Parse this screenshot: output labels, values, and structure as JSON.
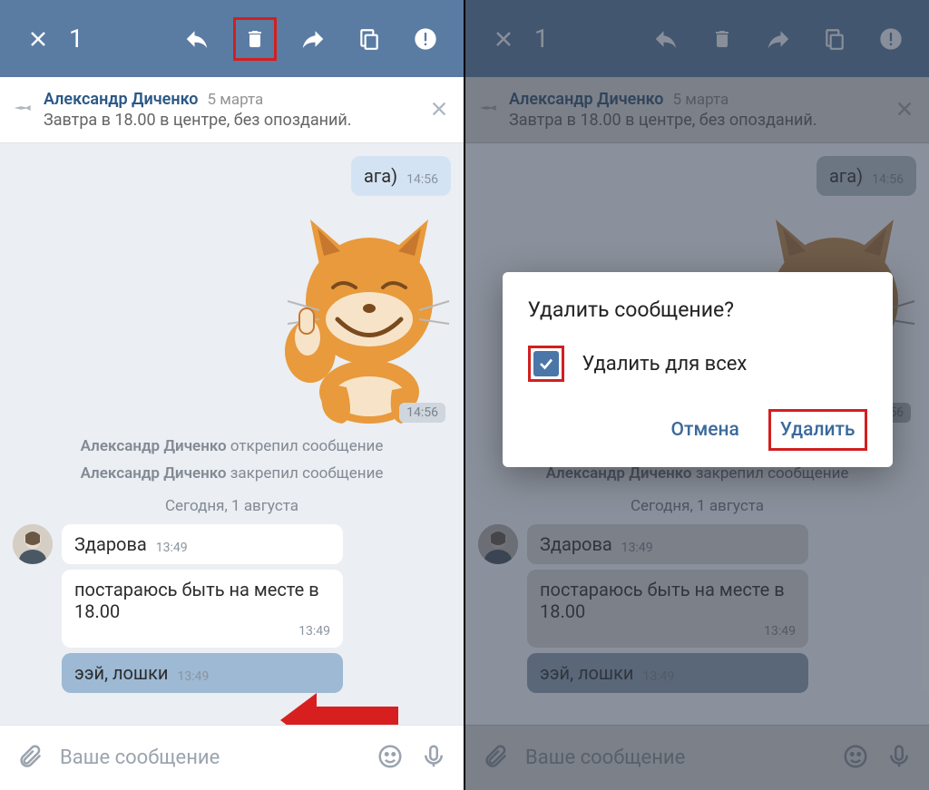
{
  "header": {
    "count": "1"
  },
  "pinned": {
    "name": "Александр Диченко",
    "date": "5 марта",
    "text": "Завтра в 18.00 в центре, без опозданий."
  },
  "messages": {
    "aga": {
      "text": "ага)",
      "time": "14:56"
    },
    "sticker_time": "14:56",
    "sys1": {
      "name": "Александр Диченко",
      "action": "открепил сообщение"
    },
    "sys2": {
      "name": "Александр Диченко",
      "action": "закрепил сообщение"
    },
    "date_sep": "Сегодня, 1 августа",
    "in1": {
      "text": "Здарова",
      "time": "13:49"
    },
    "in2": {
      "text": "постараюсь быть на месте в 18.00",
      "time": "13:49"
    },
    "in3": {
      "text": "ээй, лошки",
      "time": "13:49"
    }
  },
  "input": {
    "placeholder": "Ваше сообщение"
  },
  "dialog": {
    "title": "Удалить сообщение?",
    "option": "Удалить для всех",
    "cancel": "Отмена",
    "confirm": "Удалить"
  },
  "icons": {
    "close": "close-icon",
    "reply": "reply-icon",
    "trash": "trash-icon",
    "forward": "forward-icon",
    "copy": "copy-icon",
    "report": "report-icon",
    "pin": "pin-icon",
    "attach": "attach-icon",
    "emoji": "emoji-icon",
    "mic": "mic-icon"
  }
}
